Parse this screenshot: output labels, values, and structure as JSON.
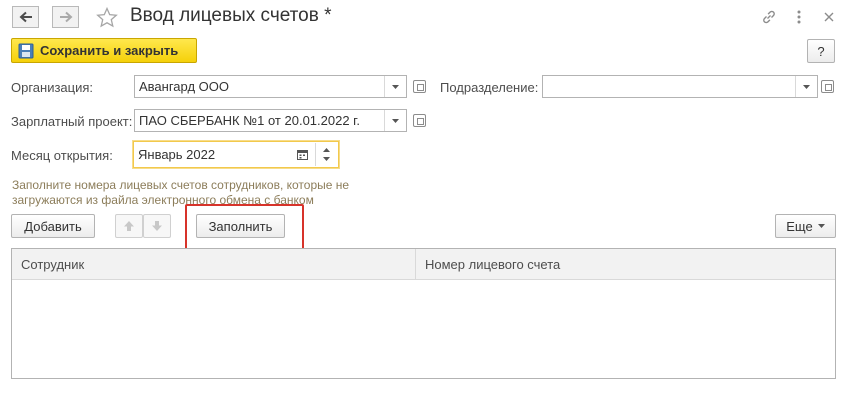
{
  "window": {
    "title": "Ввод лицевых счетов *",
    "back_icon": "arrow-left-icon",
    "forward_icon": "arrow-right-icon",
    "favorite_icon": "star-icon",
    "link_icon": "link-icon",
    "menu_icon": "kebab-menu-icon",
    "close_icon": "close-icon"
  },
  "toolbar": {
    "save_close_label": "Сохранить и закрыть",
    "help_label": "?"
  },
  "form": {
    "organization_label": "Организация:",
    "organization_value": "Авангард ООО",
    "subdivision_label": "Подразделение:",
    "subdivision_value": "",
    "salary_project_label": "Зарплатный проект:",
    "salary_project_value": "ПАО СБЕРБАНК №1 от 20.01.2022 г.",
    "open_month_label": "Месяц открытия:",
    "open_month_value": "Январь 2022"
  },
  "hint": "Заполните номера лицевых счетов сотрудников, которые не загружаются из файла электронного обмена с банком",
  "table_toolbar": {
    "add_label": "Добавить",
    "fill_label": "Заполнить",
    "more_label": "Еще"
  },
  "table": {
    "columns": [
      "Сотрудник",
      "Номер лицевого счета"
    ],
    "rows": []
  },
  "colors": {
    "accent_yellow": "#f5d10a",
    "highlight_red": "#d7332a",
    "focus_border": "#f2c94c"
  }
}
